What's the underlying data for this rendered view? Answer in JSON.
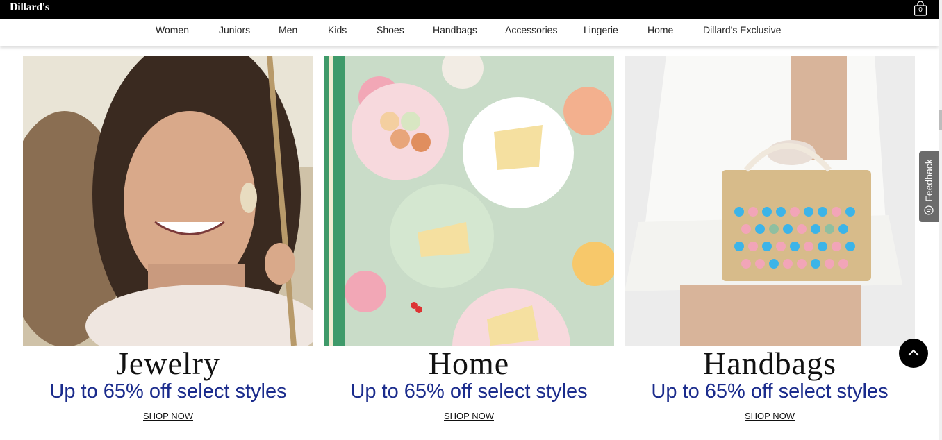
{
  "brand": {
    "logo_text": "Dillard's"
  },
  "cart": {
    "count": "0"
  },
  "nav": {
    "items": [
      {
        "label": "Women"
      },
      {
        "label": "Juniors"
      },
      {
        "label": "Men"
      },
      {
        "label": "Kids"
      },
      {
        "label": "Shoes"
      },
      {
        "label": "Handbags"
      },
      {
        "label": "Accessories"
      },
      {
        "label": "Lingerie"
      },
      {
        "label": "Home"
      },
      {
        "label": "Dillard's Exclusive"
      }
    ]
  },
  "promos": [
    {
      "title": "Jewelry",
      "subtitle": "Up to 65% off select styles",
      "cta": "SHOP NOW"
    },
    {
      "title": "Home",
      "subtitle": "Up to 65% off select styles",
      "cta": "SHOP NOW"
    },
    {
      "title": "Handbags",
      "subtitle": "Up to 65% off select styles",
      "cta": "SHOP NOW"
    }
  ],
  "feedback": {
    "label": "Feedback"
  },
  "icons": {
    "cart": "shopping-bag-icon",
    "feedback": "speech-bubble-icon",
    "back_to_top": "chevron-up-icon"
  },
  "colors": {
    "topbar": "#000000",
    "promo_subtitle": "#1a2b8c",
    "feedback_tab": "#6b6b6b"
  }
}
